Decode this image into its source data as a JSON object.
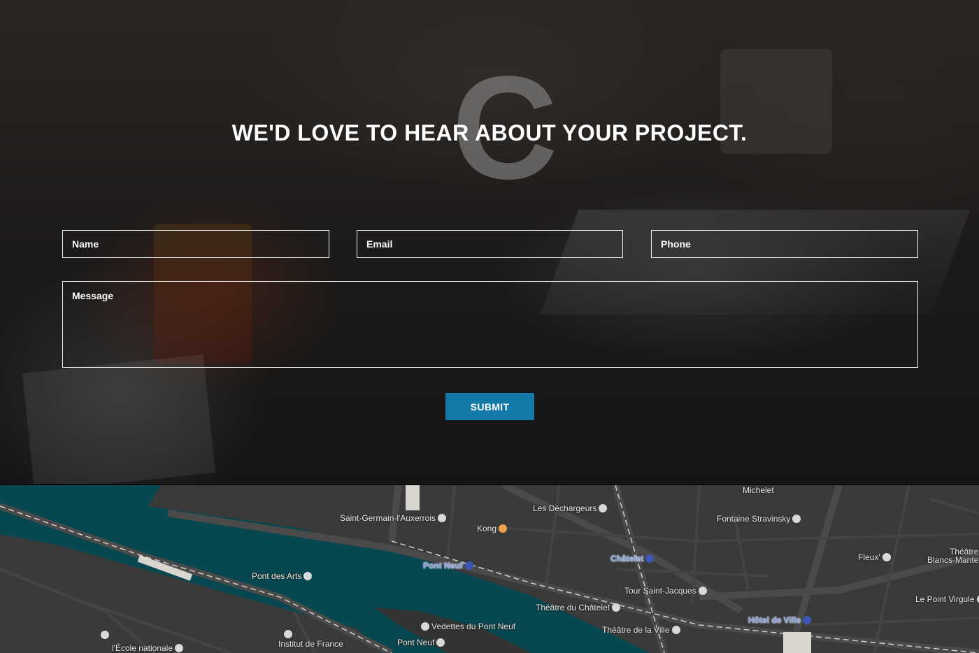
{
  "hero": {
    "background_letter": "C",
    "headline": "WE'D LOVE TO HEAR ABOUT YOUR PROJECT."
  },
  "form": {
    "name_placeholder": "Name",
    "email_placeholder": "Email",
    "phone_placeholder": "Phone",
    "message_placeholder": "Message",
    "submit_label": "SUBMIT",
    "accent_color": "#1279a8",
    "border_color": "#f2f2f2"
  },
  "map": {
    "water_color": "#07474f",
    "land_color": "#3a3a3a",
    "labels": {
      "michelet": "Michelet",
      "les_dechargeurs": "Les Déchargeurs",
      "saint_germain": "Saint-Germain-l'Auxerrois",
      "kong": "Kong",
      "fontaine_stravinsky": "Fontaine Stravinsky",
      "theatre_blancs_1": "Théâtre",
      "theatre_blancs_2": "Blancs-Mante",
      "fleux": "Fleux'",
      "chatelet": "Châtelet",
      "pont_neuf_metro": "Pont Neuf",
      "pont_des_arts": "Pont des Arts",
      "tour_saint_jacques": "Tour Saint-Jacques",
      "le_point_virgule": "Le Point Virgule",
      "theatre_du_chatelet": "Théâtre du Châtelet",
      "hotel_de_ville": "Hôtel de Ville",
      "vedettes": "Vedettes du Pont Neuf",
      "theatre_de_la_ville": "Théâtre de la Ville",
      "institut_de_france": "Institut de France",
      "pont_neuf": "Pont Neuf",
      "ecole_nationale": "l'École nationale"
    }
  }
}
